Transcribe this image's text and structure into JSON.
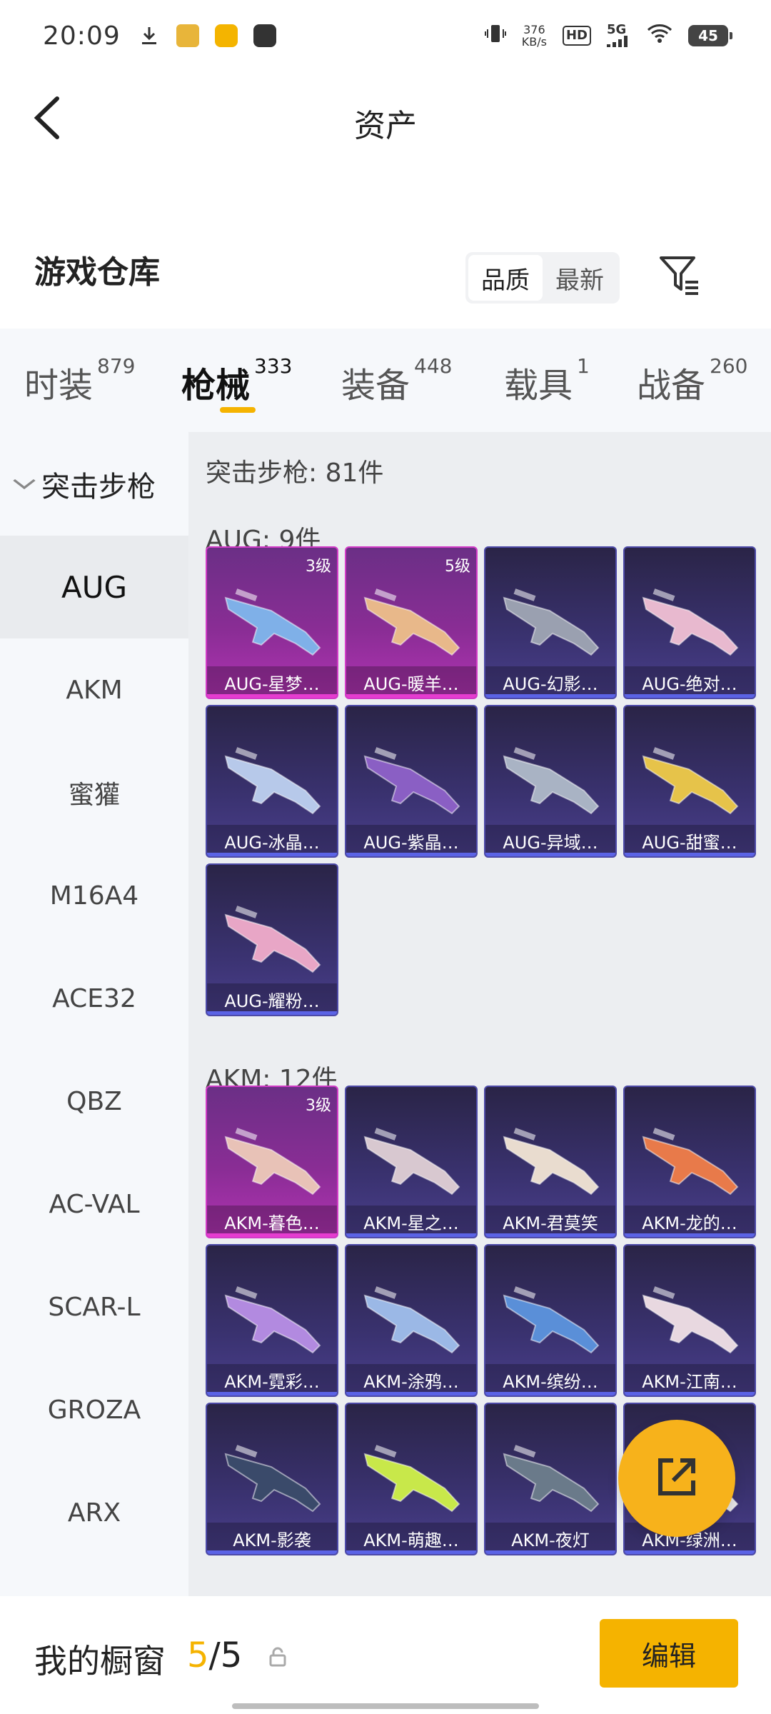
{
  "status": {
    "time": "20:09",
    "net_speed_value": "376",
    "net_speed_unit": "KB/s",
    "hd": "HD",
    "network": "5G",
    "battery": "45"
  },
  "header": {
    "title": "资产"
  },
  "warehouse": {
    "title": "游戏仓库",
    "sort_options": [
      "品质",
      "最新"
    ],
    "sort_selected": "品质"
  },
  "categories": [
    {
      "label": "时装",
      "count": "879"
    },
    {
      "label": "枪械",
      "count": "333",
      "active": true
    },
    {
      "label": "装备",
      "count": "448"
    },
    {
      "label": "载具",
      "count": "1"
    },
    {
      "label": "战备",
      "count": "260"
    }
  ],
  "sidebar": {
    "group": "突击步枪",
    "items": [
      "AUG",
      "AKM",
      "蜜獾",
      "M16A4",
      "ACE32",
      "QBZ",
      "AC-VAL",
      "SCAR-L",
      "GROZA",
      "ARX"
    ],
    "selected": "AUG"
  },
  "main": {
    "summary": "突击步枪: 81件",
    "sections": [
      {
        "title": "AUG: 9件",
        "items": [
          {
            "label": "AUG-星梦…",
            "level": "3级",
            "rarity": "purple"
          },
          {
            "label": "AUG-暖羊…",
            "level": "5级",
            "rarity": "purple"
          },
          {
            "label": "AUG-幻影…",
            "level": "",
            "rarity": "blue"
          },
          {
            "label": "AUG-绝对…",
            "level": "",
            "rarity": "blue"
          },
          {
            "label": "AUG-冰晶…",
            "level": "",
            "rarity": "blue"
          },
          {
            "label": "AUG-紫晶…",
            "level": "",
            "rarity": "blue"
          },
          {
            "label": "AUG-异域…",
            "level": "",
            "rarity": "blue"
          },
          {
            "label": "AUG-甜蜜…",
            "level": "",
            "rarity": "blue"
          },
          {
            "label": "AUG-耀粉…",
            "level": "",
            "rarity": "blue"
          }
        ]
      },
      {
        "title": "AKM: 12件",
        "items": [
          {
            "label": "AKM-暮色…",
            "level": "3级",
            "rarity": "purple"
          },
          {
            "label": "AKM-星之…",
            "level": "",
            "rarity": "blue"
          },
          {
            "label": "AKM-君莫笑",
            "level": "",
            "rarity": "blue"
          },
          {
            "label": "AKM-龙的…",
            "level": "",
            "rarity": "blue"
          },
          {
            "label": "AKM-霓彩…",
            "level": "",
            "rarity": "blue"
          },
          {
            "label": "AKM-涂鸦…",
            "level": "",
            "rarity": "blue"
          },
          {
            "label": "AKM-缤纷…",
            "level": "",
            "rarity": "blue"
          },
          {
            "label": "AKM-江南…",
            "level": "",
            "rarity": "blue"
          },
          {
            "label": "AKM-影袭",
            "level": "",
            "rarity": "blue"
          },
          {
            "label": "AKM-萌趣…",
            "level": "",
            "rarity": "blue"
          },
          {
            "label": "AKM-夜灯",
            "level": "",
            "rarity": "blue"
          },
          {
            "label": "AKM-绿洲…",
            "level": "",
            "rarity": "blue"
          }
        ]
      }
    ]
  },
  "bottom": {
    "label": "我的橱窗",
    "count_current": "5",
    "count_separator": "/",
    "count_total": "5",
    "edit_label": "编辑"
  },
  "colors": {
    "accent": "#f5b300",
    "purple_rarity": "#b033b2",
    "blue_rarity": "#4a3f8c"
  }
}
